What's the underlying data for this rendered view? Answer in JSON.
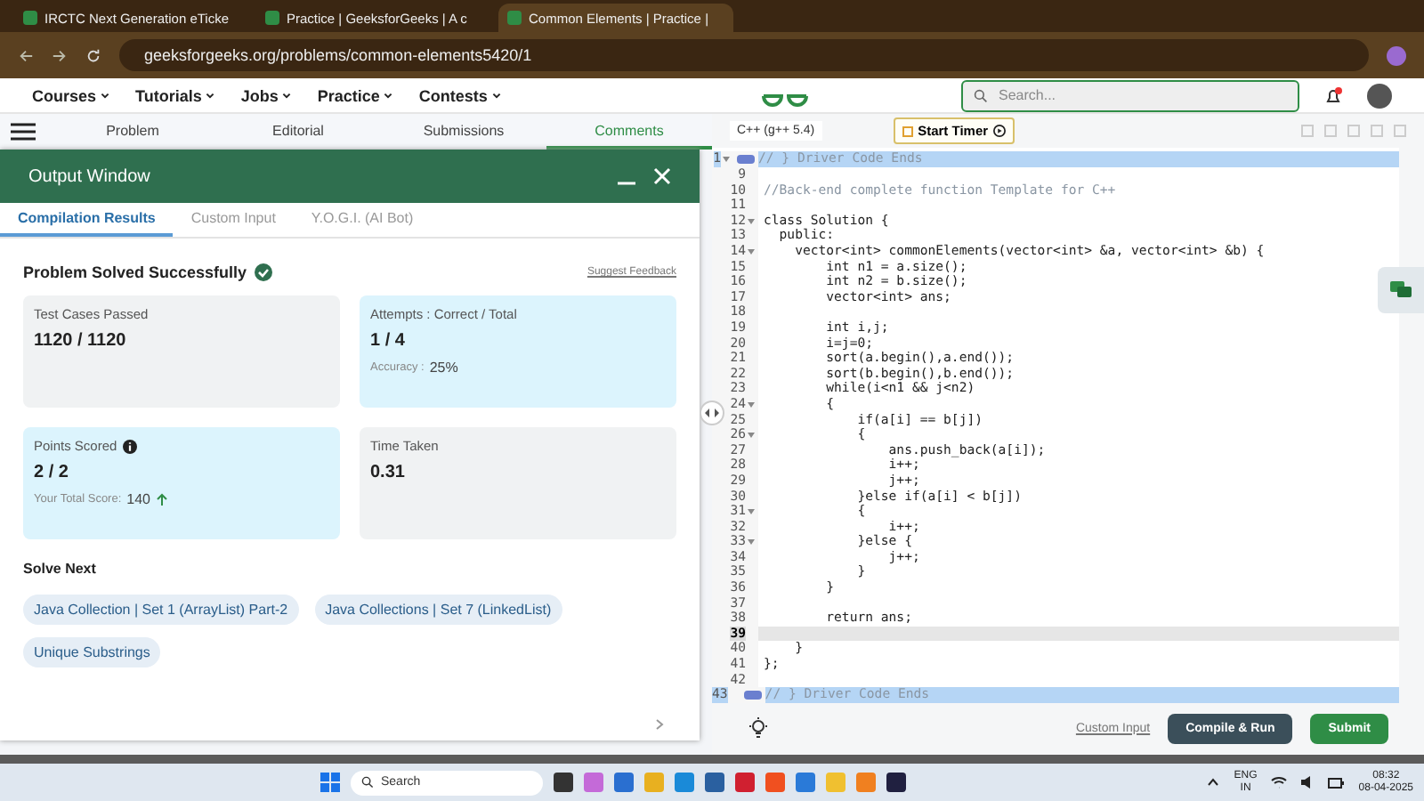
{
  "browser": {
    "tabs": [
      {
        "title": "IRCTC Next Generation eTicke",
        "selected": false
      },
      {
        "title": "Practice | GeeksforGeeks | A c",
        "selected": false
      },
      {
        "title": "Common Elements | Practice |",
        "selected": true
      }
    ],
    "url": "geeksforgeeks.org/problems/common-elements5420/1"
  },
  "site_nav": {
    "menu": [
      "Courses",
      "Tutorials",
      "Jobs",
      "Practice",
      "Contests"
    ],
    "search": {
      "placeholder": "Search..."
    }
  },
  "problem_tabs": [
    {
      "label": "Problem",
      "selected": false
    },
    {
      "label": "Editorial",
      "selected": false
    },
    {
      "label": "Submissions",
      "selected": false
    },
    {
      "label": "Comments",
      "selected": true
    }
  ],
  "output_window": {
    "title": "Output Window",
    "tabs": [
      {
        "label": "Compilation Results",
        "selected": true
      },
      {
        "label": "Custom Input",
        "selected": false
      },
      {
        "label": "Y.O.G.I. (AI Bot)",
        "selected": false
      }
    ],
    "status": "Problem Solved Successfully",
    "feedback_link": "Suggest Feedback",
    "cards": [
      {
        "label": "Test Cases Passed",
        "value": "1120 / 1120",
        "highlighted": false,
        "info_icon": false
      },
      {
        "label": "Attempts : Correct / Total",
        "value": "1 / 4",
        "note_label": "Accuracy :",
        "note_value": "25%",
        "trend_up": false,
        "highlighted": true,
        "info_icon": false
      },
      {
        "label": "Points Scored",
        "value": "2 / 2",
        "note_label": "Your Total Score:",
        "note_value": "140",
        "trend_up": true,
        "highlighted": true,
        "info_icon": true
      },
      {
        "label": "Time Taken",
        "value": "0.31",
        "highlighted": false,
        "info_icon": false
      }
    ],
    "solve_next": {
      "heading": "Solve Next",
      "items": [
        "Java Collection | Set 1 (ArrayList) Part-2",
        "Java Collections | Set 7 (LinkedList)",
        "Unique Substrings"
      ]
    }
  },
  "editor": {
    "language": "C++ (g++ 5.4)",
    "timer_button": "Start Timer",
    "lines": [
      {
        "number": "1",
        "text": "// } Driver Code Ends",
        "kind": "comment",
        "foldable": true,
        "folded": true,
        "selected": true,
        "current": false
      },
      {
        "number": "9",
        "foldable": false,
        "folded": false,
        "selected": false,
        "current": false
      },
      {
        "number": "10",
        "text": "//Back-end complete function Template for C++",
        "kind": "comment",
        "foldable": false,
        "folded": false,
        "selected": false,
        "current": false
      },
      {
        "number": "11",
        "foldable": false,
        "folded": false,
        "selected": false,
        "current": false
      },
      {
        "number": "12",
        "text": "class Solution {",
        "kind": "code",
        "foldable": true,
        "folded": false,
        "selected": false,
        "current": false
      },
      {
        "number": "13",
        "text": "  public:",
        "kind": "code",
        "foldable": false,
        "folded": false,
        "selected": false,
        "current": false
      },
      {
        "number": "14",
        "text": "    vector<int> commonElements(vector<int> &a, vector<int> &b) {",
        "kind": "code",
        "foldable": true,
        "folded": false,
        "selected": false,
        "current": false
      },
      {
        "number": "15",
        "text": "        int n1 = a.size();",
        "kind": "code",
        "foldable": false,
        "folded": false,
        "selected": false,
        "current": false
      },
      {
        "number": "16",
        "text": "        int n2 = b.size();",
        "kind": "code",
        "foldable": false,
        "folded": false,
        "selected": false,
        "current": false
      },
      {
        "number": "17",
        "text": "        vector<int> ans;",
        "kind": "code",
        "foldable": false,
        "folded": false,
        "selected": false,
        "current": false
      },
      {
        "number": "18",
        "foldable": false,
        "folded": false,
        "selected": false,
        "current": false
      },
      {
        "number": "19",
        "text": "        int i,j;",
        "kind": "code",
        "foldable": false,
        "folded": false,
        "selected": false,
        "current": false
      },
      {
        "number": "20",
        "text": "        i=j=0;",
        "kind": "code",
        "foldable": false,
        "folded": false,
        "selected": false,
        "current": false
      },
      {
        "number": "21",
        "text": "        sort(a.begin(),a.end());",
        "kind": "code",
        "foldable": false,
        "folded": false,
        "selected": false,
        "current": false
      },
      {
        "number": "22",
        "text": "        sort(b.begin(),b.end());",
        "kind": "code",
        "foldable": false,
        "folded": false,
        "selected": false,
        "current": false
      },
      {
        "number": "23",
        "text": "        while(i<n1 && j<n2)",
        "kind": "code",
        "foldable": false,
        "folded": false,
        "selected": false,
        "current": false
      },
      {
        "number": "24",
        "text": "        {",
        "kind": "code",
        "foldable": true,
        "folded": false,
        "selected": false,
        "current": false
      },
      {
        "number": "25",
        "text": "            if(a[i] == b[j])",
        "kind": "code",
        "foldable": false,
        "folded": false,
        "selected": false,
        "current": false
      },
      {
        "number": "26",
        "text": "            {",
        "kind": "code",
        "foldable": true,
        "folded": false,
        "selected": false,
        "current": false
      },
      {
        "number": "27",
        "text": "                ans.push_back(a[i]);",
        "kind": "code",
        "foldable": false,
        "folded": false,
        "selected": false,
        "current": false
      },
      {
        "number": "28",
        "text": "                i++;",
        "kind": "code",
        "foldable": false,
        "folded": false,
        "selected": false,
        "current": false
      },
      {
        "number": "29",
        "text": "                j++;",
        "kind": "code",
        "foldable": false,
        "folded": false,
        "selected": false,
        "current": false
      },
      {
        "number": "30",
        "text": "            }else if(a[i] < b[j])",
        "kind": "code",
        "foldable": false,
        "folded": false,
        "selected": false,
        "current": false
      },
      {
        "number": "31",
        "text": "            {",
        "kind": "code",
        "foldable": true,
        "folded": false,
        "selected": false,
        "current": false
      },
      {
        "number": "32",
        "text": "                i++;",
        "kind": "code",
        "foldable": false,
        "folded": false,
        "selected": false,
        "current": false
      },
      {
        "number": "33",
        "text": "            }else {",
        "kind": "code",
        "foldable": true,
        "folded": false,
        "selected": false,
        "current": false
      },
      {
        "number": "34",
        "text": "                j++;",
        "kind": "code",
        "foldable": false,
        "folded": false,
        "selected": false,
        "current": false
      },
      {
        "number": "35",
        "text": "            }",
        "kind": "code",
        "foldable": false,
        "folded": false,
        "selected": false,
        "current": false
      },
      {
        "number": "36",
        "text": "        }",
        "kind": "code",
        "foldable": false,
        "folded": false,
        "selected": false,
        "current": false
      },
      {
        "number": "37",
        "foldable": false,
        "folded": false,
        "selected": false,
        "current": false
      },
      {
        "number": "38",
        "text": "        return ans;",
        "kind": "code",
        "foldable": false,
        "folded": false,
        "selected": false,
        "current": false
      },
      {
        "number": "39",
        "foldable": false,
        "folded": false,
        "selected": false,
        "current": true
      },
      {
        "number": "40",
        "text": "    }",
        "kind": "code",
        "foldable": false,
        "folded": false,
        "selected": false,
        "current": false
      },
      {
        "number": "41",
        "text": "};",
        "kind": "code",
        "foldable": false,
        "folded": false,
        "selected": false,
        "current": false
      },
      {
        "number": "42",
        "foldable": false,
        "folded": false,
        "selected": false,
        "current": false
      },
      {
        "number": "43",
        "text": "// } Driver Code Ends",
        "kind": "comment",
        "foldable": false,
        "folded": true,
        "selected": true,
        "current": false
      }
    ],
    "custom_input_link": "Custom Input",
    "compile_button": "Compile & Run",
    "submit_button": "Submit"
  },
  "taskbar": {
    "search": {
      "placeholder": "Search"
    },
    "language": "ENG",
    "region": "IN",
    "time": "08:32",
    "date": "08-04-2025"
  }
}
